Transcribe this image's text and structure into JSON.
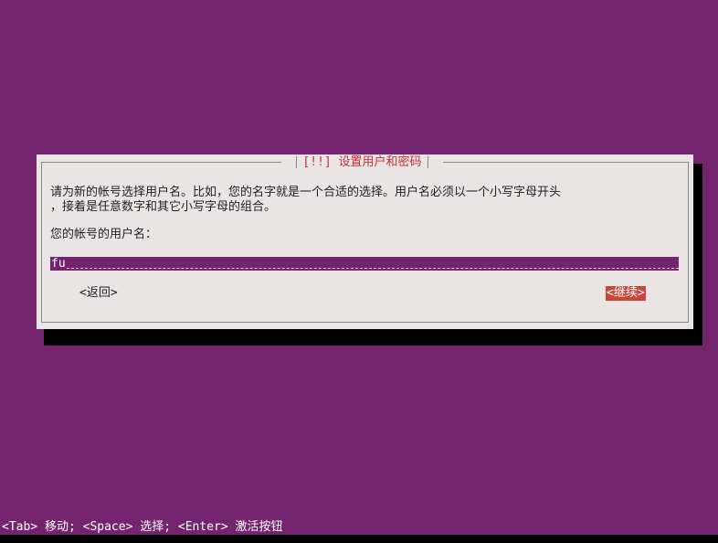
{
  "dialog": {
    "title": "[!!] 设置用户和密码",
    "description_line1": "请为新的帐号选择用户名。比如，您的名字就是一个合适的选择。用户名必须以一个小写字母开头",
    "description_line2": "，接着是任意数字和其它小写字母的组合。",
    "prompt": "您的帐号的用户名：",
    "username_value": "fu",
    "back_label": "<返回>",
    "continue_label": "<继续>"
  },
  "status_bar": {
    "text": "<Tab> 移动; <Space> 选择; <Enter> 激活按钮"
  },
  "colors": {
    "background": "#74246e",
    "dialog": "#e9e5e5",
    "accent": "#c8473a",
    "shadow": "#000000"
  }
}
